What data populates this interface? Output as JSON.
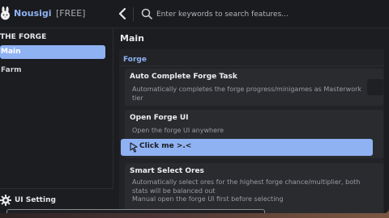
{
  "app": {
    "name": "Nousigi",
    "tier": "[FREE]"
  },
  "search": {
    "placeholder": "Enter keywords to search features..."
  },
  "sidebar": {
    "section_title": "THE FORGE",
    "items": [
      {
        "label": "Main",
        "active": true
      },
      {
        "label": "Farm",
        "active": false
      }
    ],
    "settings_label": "UI Setting"
  },
  "main": {
    "title": "Main",
    "group_label": "Forge",
    "cards": [
      {
        "title": "Auto Complete Forge Task",
        "description": "Automatically completes the forge progress/minigames as Masterwork tier",
        "toggle_on": false
      },
      {
        "title": "Open Forge UI",
        "description": "Open the forge UI anywhere",
        "button_label": "Click me >.<"
      },
      {
        "title": "Smart Select Ores",
        "description": "Automatically select ores for the highest forge chance/multiplier, both stats will be balanced out",
        "description_2": "Manual open the forge UI first before selecting"
      }
    ]
  },
  "colors": {
    "accent": "#8fb2f3",
    "background": "#1c1d20",
    "card": "#2a2b2f"
  }
}
